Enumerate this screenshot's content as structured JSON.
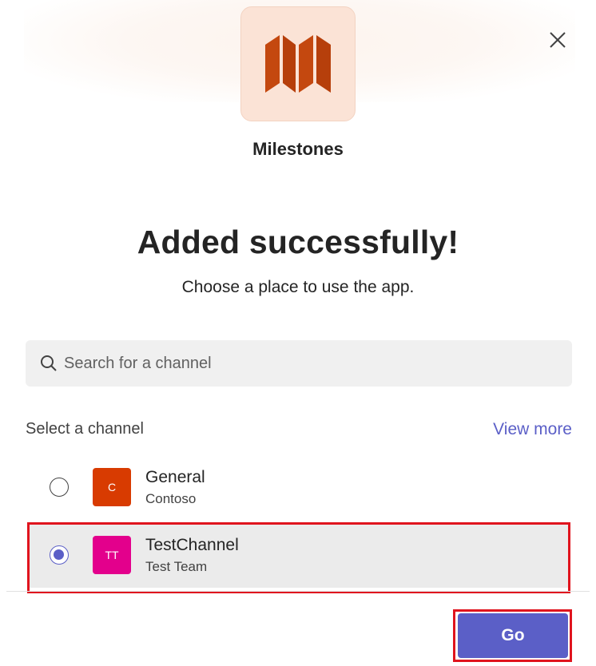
{
  "app": {
    "name": "Milestones",
    "icon": "milestones-map-icon",
    "icon_color": "#c4480f",
    "tile_color": "#fbe3d6"
  },
  "dialog": {
    "headline": "Added successfully!",
    "subtext": "Choose a place to use the app.",
    "close_icon": "close-icon"
  },
  "search": {
    "placeholder": "Search for a channel",
    "value": "",
    "icon": "search-icon"
  },
  "channels": {
    "section_label": "Select a channel",
    "view_more_label": "View more",
    "items": [
      {
        "name": "General",
        "team": "Contoso",
        "initials": "C",
        "avatar_color": "#d83b01",
        "selected": false
      },
      {
        "name": "TestChannel",
        "team": "Test Team",
        "initials": "TT",
        "avatar_color": "#e3008c",
        "selected": true
      }
    ]
  },
  "footer": {
    "go_label": "Go"
  },
  "colors": {
    "accent": "#5b5fc7",
    "highlight_outline": "#e0141e"
  }
}
